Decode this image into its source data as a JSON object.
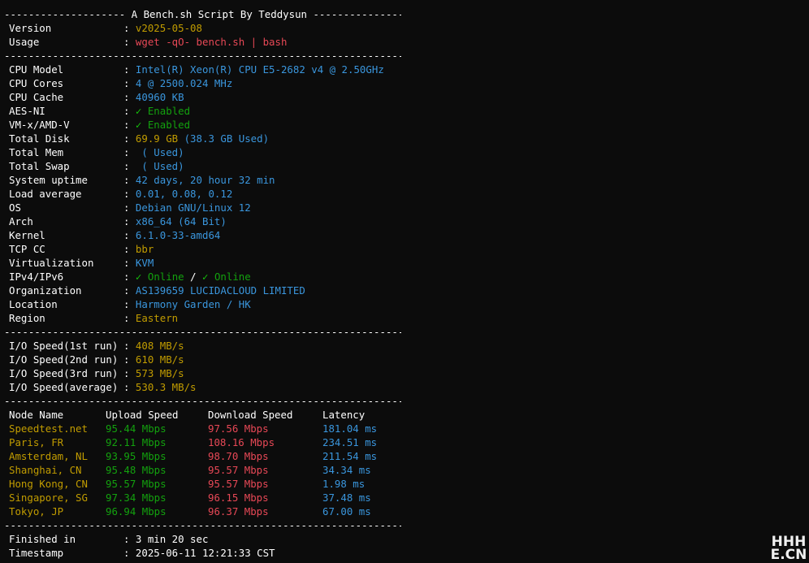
{
  "header": {
    "title_line": "-------------------- A Bench.sh Script By Teddysun -------------------",
    "version_label": "Version",
    "version_value": "v2025-05-08",
    "usage_label": "Usage",
    "usage_value": "wget -qO- bench.sh | bash"
  },
  "separator": "----------------------------------------------------------------------",
  "system": [
    {
      "label": "CPU Model",
      "value": "Intel(R) Xeon(R) CPU E5-2682 v4 @ 2.50GHz",
      "color": "cyan"
    },
    {
      "label": "CPU Cores",
      "value": "4 @ 2500.024 MHz",
      "color": "cyan"
    },
    {
      "label": "CPU Cache",
      "value": "40960 KB",
      "color": "cyan"
    },
    {
      "label": "AES-NI",
      "check": "✓",
      "value": "Enabled",
      "color": "green"
    },
    {
      "label": "VM-x/AMD-V",
      "check": "✓",
      "value": "Enabled",
      "color": "green"
    },
    {
      "label": "Total Disk",
      "value": "69.9 GB",
      "extra": " (38.3 GB Used)",
      "color": "yellow",
      "extra_color": "cyan"
    },
    {
      "label": "Total Mem",
      "value": " ( Used)",
      "color": "cyan"
    },
    {
      "label": "Total Swap",
      "value": " ( Used)",
      "color": "cyan"
    },
    {
      "label": "System uptime",
      "value": "42 days, 20 hour 32 min",
      "color": "cyan"
    },
    {
      "label": "Load average",
      "value": "0.01, 0.08, 0.12",
      "color": "cyan"
    },
    {
      "label": "OS",
      "value": "Debian GNU/Linux 12",
      "color": "cyan"
    },
    {
      "label": "Arch",
      "value": "x86_64 (64 Bit)",
      "color": "cyan"
    },
    {
      "label": "Kernel",
      "value": "6.1.0-33-amd64",
      "color": "cyan"
    },
    {
      "label": "TCP CC",
      "value": "bbr",
      "color": "yellow"
    },
    {
      "label": "Virtualization",
      "value": "KVM",
      "color": "cyan"
    }
  ],
  "ipv": {
    "label": "IPv4/IPv6",
    "check": "✓",
    "v4": "Online",
    "slash": " / ",
    "v6": "Online"
  },
  "network": [
    {
      "label": "Organization",
      "value": "AS139659 LUCIDACLOUD LIMITED",
      "color": "cyan"
    },
    {
      "label": "Location",
      "value": "Harmony Garden / HK",
      "color": "cyan"
    },
    {
      "label": "Region",
      "value": "Eastern",
      "color": "yellow"
    }
  ],
  "io": [
    {
      "label": "I/O Speed(1st run)",
      "value": "408 MB/s"
    },
    {
      "label": "I/O Speed(2nd run)",
      "value": "610 MB/s"
    },
    {
      "label": "I/O Speed(3rd run)",
      "value": "573 MB/s"
    },
    {
      "label": "I/O Speed(average)",
      "value": "530.3 MB/s"
    }
  ],
  "speedtest": {
    "headers": {
      "node": "Node Name",
      "upload": "Upload Speed",
      "download": "Download Speed",
      "latency": "Latency"
    },
    "rows": [
      {
        "node": "Speedtest.net",
        "upload": "95.44 Mbps",
        "download": "97.56 Mbps",
        "latency": "181.04 ms"
      },
      {
        "node": "Paris, FR",
        "upload": "92.11 Mbps",
        "download": "108.16 Mbps",
        "latency": "234.51 ms"
      },
      {
        "node": "Amsterdam, NL",
        "upload": "93.95 Mbps",
        "download": "98.70 Mbps",
        "latency": "211.54 ms"
      },
      {
        "node": "Shanghai, CN",
        "upload": "95.48 Mbps",
        "download": "95.57 Mbps",
        "latency": "34.34 ms"
      },
      {
        "node": "Hong Kong, CN",
        "upload": "95.57 Mbps",
        "download": "95.57 Mbps",
        "latency": "1.98 ms"
      },
      {
        "node": "Singapore, SG",
        "upload": "97.34 Mbps",
        "download": "96.15 Mbps",
        "latency": "37.48 ms"
      },
      {
        "node": "Tokyo, JP",
        "upload": "96.94 Mbps",
        "download": "96.37 Mbps",
        "latency": "67.00 ms"
      }
    ]
  },
  "footer": {
    "finished_label": "Finished in",
    "finished_value": "3 min 20 sec",
    "timestamp_label": "Timestamp",
    "timestamp_value": "2025-06-11 12:21:33 CST"
  },
  "watermark": {
    "line1": "HHH",
    "line2": "E.CN"
  },
  "colors": {
    "background": "#0c0c0c",
    "text": "#ffffff",
    "cyan": "#3a96dd",
    "green": "#13a10e",
    "yellow": "#c19c00",
    "red": "#e74856"
  }
}
